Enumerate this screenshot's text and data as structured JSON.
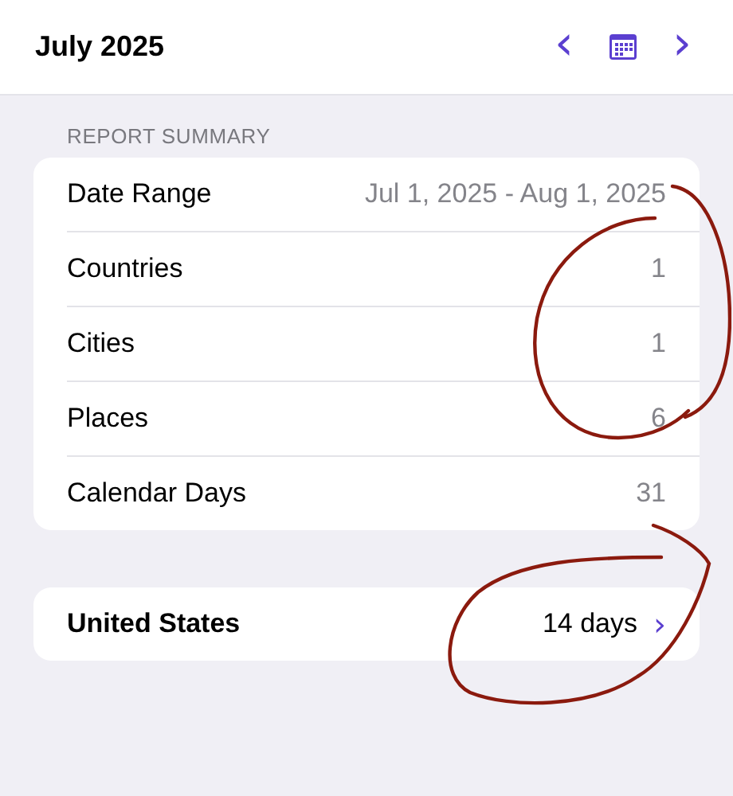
{
  "header": {
    "title": "July 2025",
    "prev": "‹",
    "next": "›"
  },
  "summary": {
    "heading": "REPORT SUMMARY",
    "rows": [
      {
        "label": "Date Range",
        "value": "Jul 1, 2025 - Aug 1, 2025"
      },
      {
        "label": "Countries",
        "value": "1"
      },
      {
        "label": "Cities",
        "value": "1"
      },
      {
        "label": "Places",
        "value": "6"
      },
      {
        "label": "Calendar Days",
        "value": "31"
      }
    ]
  },
  "countries": [
    {
      "name": "United States",
      "days": "14 days",
      "chevron": "›"
    }
  ]
}
